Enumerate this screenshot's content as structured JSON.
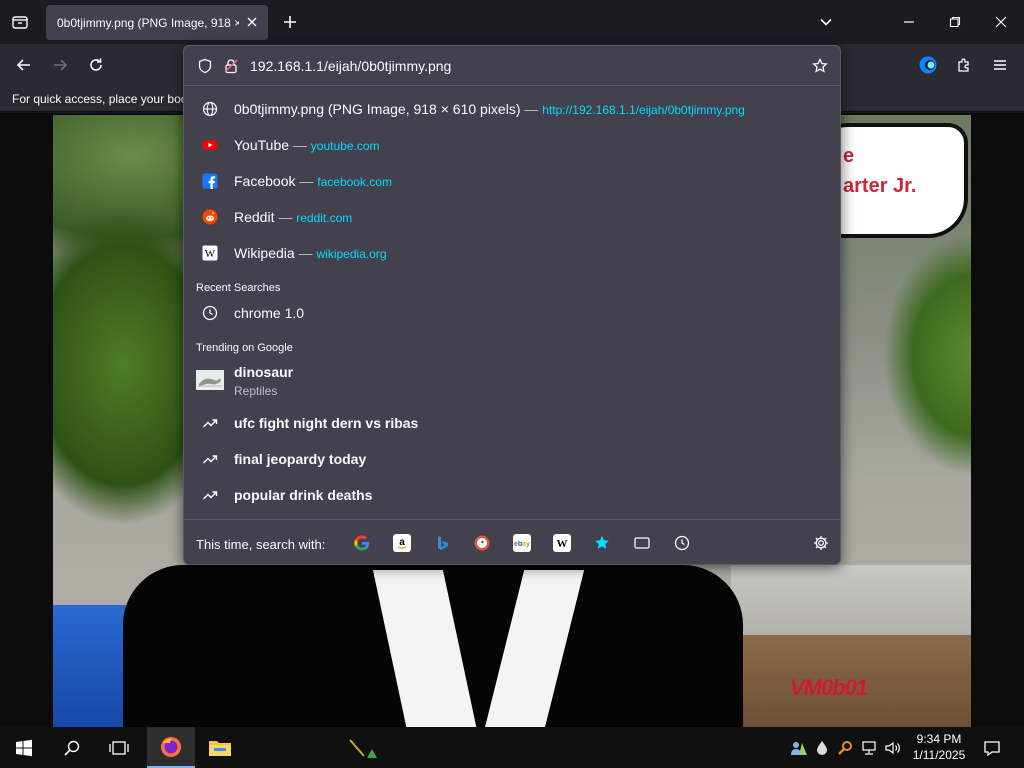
{
  "browser": {
    "tab": {
      "title": "0b0tjimmy.png (PNG Image, 918 ×"
    },
    "bookmarks_bar_text": "For quick access, place your boo"
  },
  "urlbar": {
    "url": "192.168.1.1/eijah/0b0tjimmy.png",
    "results": [
      {
        "icon": "globe-icon",
        "title": "0b0tjimmy.png (PNG Image, 918 × 610 pixels)",
        "sep": "—",
        "url": "http://192.168.1.1/eijah/0b0tjimmy.png"
      },
      {
        "icon": "youtube-icon",
        "title": "YouTube",
        "sep": "—",
        "url": "youtube.com"
      },
      {
        "icon": "facebook-icon",
        "title": "Facebook",
        "sep": "—",
        "url": "facebook.com"
      },
      {
        "icon": "reddit-icon",
        "title": "Reddit",
        "sep": "—",
        "url": "reddit.com"
      },
      {
        "icon": "wikipedia-icon",
        "title": "Wikipedia",
        "sep": "—",
        "url": "wikipedia.org"
      }
    ],
    "recent_header": "Recent Searches",
    "recent": [
      {
        "icon": "clock-icon",
        "text": "chrome 1.0"
      }
    ],
    "trending_header": "Trending on Google",
    "trending": [
      {
        "icon": "dinosaur-thumbnail",
        "text": "dinosaur",
        "sub": "Reptiles"
      },
      {
        "icon": "trending-icon",
        "text": "ufc fight night dern vs ribas"
      },
      {
        "icon": "trending-icon",
        "text": "final jeopardy today"
      },
      {
        "icon": "trending-icon",
        "text": "popular drink deaths"
      }
    ],
    "search_with_label": "This time, search with:",
    "engines": [
      "google-icon",
      "amazon-icon",
      "bing-icon",
      "duckduckgo-icon",
      "ebay-icon",
      "wikipedia-icon",
      "bookmarks-icon",
      "tabs-icon",
      "history-icon"
    ]
  },
  "image": {
    "bubble_text": "e\narter Jr.",
    "watermark": "VM0b01"
  },
  "taskbar": {
    "time": "9:34 PM",
    "date": "1/11/2025"
  },
  "colors": {
    "accent_link": "#00ddff",
    "panel": "#42414d",
    "toolbar": "#2b2a33"
  }
}
